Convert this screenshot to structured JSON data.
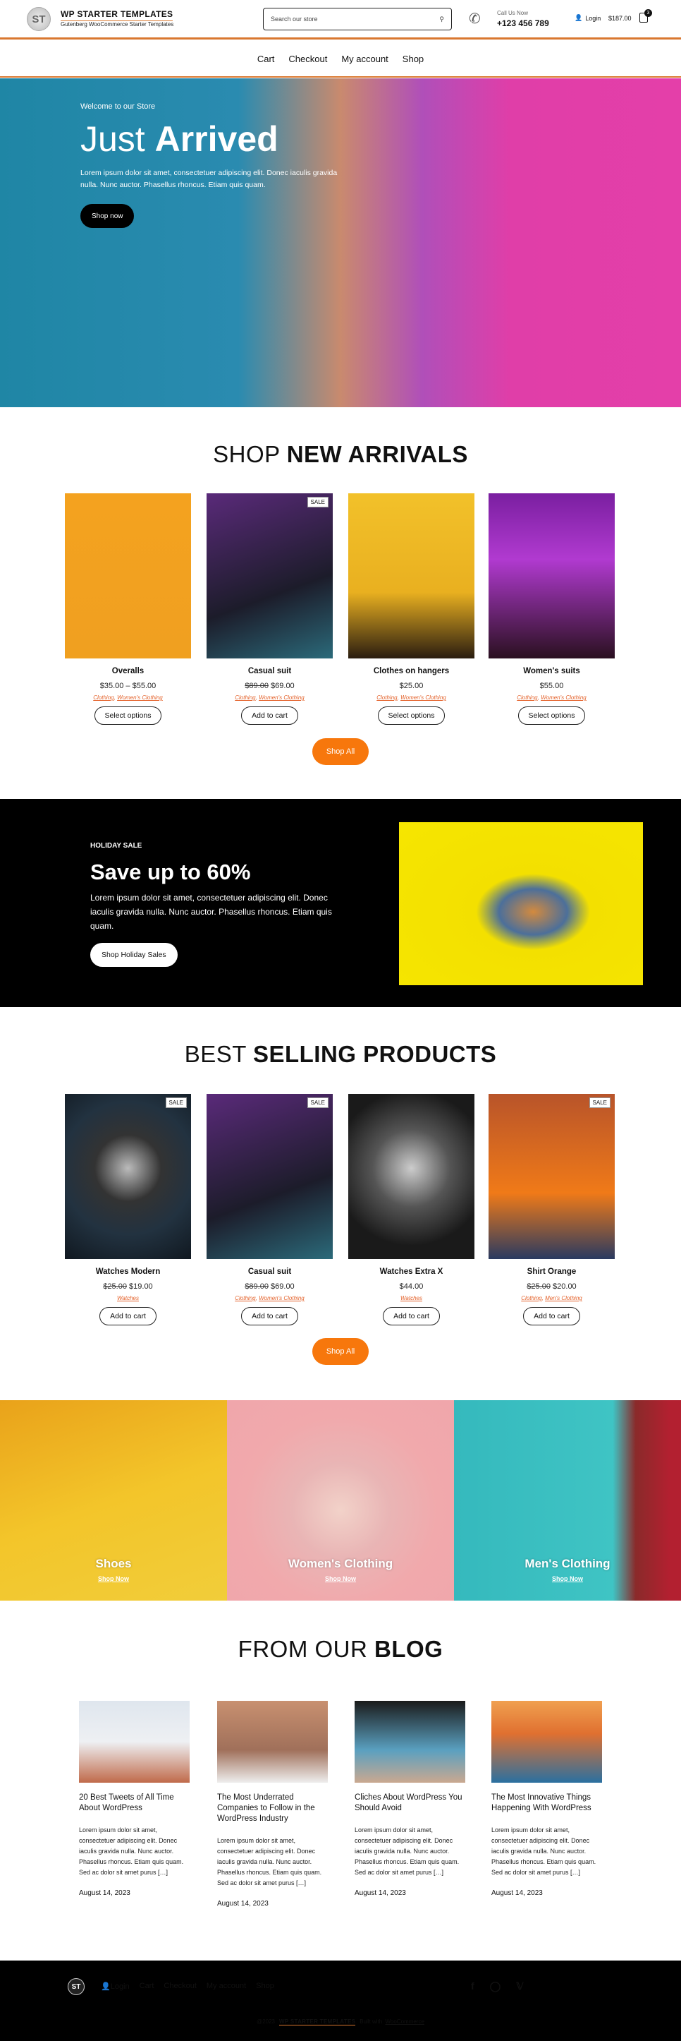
{
  "header": {
    "brand": "WP STARTER TEMPLATES",
    "tagline": "Gutenberg WooCommerce Starter Templates",
    "logo_text": "ST",
    "search_placeholder": "Search our store",
    "call_label": "Call Us Now",
    "phone": "+123 456 789",
    "login": "Login",
    "cart_total": "$187.00",
    "cart_count": "3"
  },
  "nav": [
    "Cart",
    "Checkout",
    "My account",
    "Shop"
  ],
  "hero": {
    "subtitle": "Welcome to our Store",
    "title_light": "Just ",
    "title_bold": "Arrived",
    "text": "Lorem ipsum dolor sit amet, consectetuer adipiscing elit. Donec iaculis gravida nulla. Nunc auctor. Phasellus rhoncus. Etiam quis quam.",
    "button": "Shop now"
  },
  "new_arrivals": {
    "title_light": "SHOP ",
    "title_bold": "NEW ARRIVALS",
    "shop_all": "Shop All",
    "products": [
      {
        "name": "Overalls",
        "price": "$35.00 – $55.00",
        "old_price": "",
        "sale": "",
        "cats": [
          "Clothing",
          "Women's Clothing"
        ],
        "button": "Select options"
      },
      {
        "name": "Casual suit",
        "price": "$69.00",
        "old_price": "$89.00",
        "sale": "SALE",
        "cats": [
          "Clothing",
          "Women's Clothing"
        ],
        "button": "Add to cart"
      },
      {
        "name": "Clothes on hangers",
        "price": "$25.00",
        "old_price": "",
        "sale": "",
        "cats": [
          "Clothing",
          "Women's Clothing"
        ],
        "button": "Select options"
      },
      {
        "name": "Women's suits",
        "price": "$55.00",
        "old_price": "",
        "sale": "",
        "cats": [
          "Clothing",
          "Women's Clothing"
        ],
        "button": "Select options"
      }
    ]
  },
  "holiday": {
    "label": "HOLIDAY SALE",
    "title": "Save up to 60%",
    "text": "Lorem ipsum dolor sit amet, consectetuer adipiscing elit. Donec iaculis gravida nulla. Nunc auctor. Phasellus rhoncus. Etiam quis quam.",
    "button": "Shop Holiday Sales"
  },
  "best_selling": {
    "title_light": "BEST ",
    "title_bold": "SELLING PRODUCTS",
    "shop_all": "Shop All",
    "products": [
      {
        "name": "Watches Modern",
        "price": "$19.00",
        "old_price": "$25.00",
        "sale": "SALE",
        "cats": [
          "Watches"
        ],
        "button": "Add to cart"
      },
      {
        "name": "Casual suit",
        "price": "$69.00",
        "old_price": "$89.00",
        "sale": "SALE",
        "cats": [
          "Clothing",
          "Women's Clothing"
        ],
        "button": "Add to cart"
      },
      {
        "name": "Watches Extra X",
        "price": "$44.00",
        "old_price": "",
        "sale": "",
        "cats": [
          "Watches"
        ],
        "button": "Add to cart"
      },
      {
        "name": "Shirt Orange",
        "price": "$20.00",
        "old_price": "$25.00",
        "sale": "SALE",
        "cats": [
          "Clothing",
          "Men's Clothing"
        ],
        "button": "Add to cart"
      }
    ]
  },
  "categories": [
    {
      "name": "Shoes",
      "link": "Shop Now"
    },
    {
      "name": "Women's Clothing",
      "link": "Shop Now"
    },
    {
      "name": "Men's Clothing",
      "link": "Shop Now"
    }
  ],
  "blog": {
    "title_light": "FROM OUR ",
    "title_bold": "BLOG",
    "posts": [
      {
        "title": "20 Best Tweets of All Time About WordPress",
        "excerpt": "Lorem ipsum dolor sit amet, consectetuer adipiscing elit. Donec iaculis gravida nulla. Nunc auctor. Phasellus rhoncus. Etiam quis quam. Sed ac dolor sit amet purus […]",
        "date": "August 14, 2023"
      },
      {
        "title": "The Most Underrated Companies to Follow in the WordPress Industry",
        "excerpt": "Lorem ipsum dolor sit amet, consectetuer adipiscing elit. Donec iaculis gravida nulla. Nunc auctor. Phasellus rhoncus. Etiam quis quam. Sed ac dolor sit amet purus […]",
        "date": "August 14, 2023"
      },
      {
        "title": "Cliches About WordPress You Should Avoid",
        "excerpt": "Lorem ipsum dolor sit amet, consectetuer adipiscing elit. Donec iaculis gravida nulla. Nunc auctor. Phasellus rhoncus. Etiam quis quam. Sed ac dolor sit amet purus […]",
        "date": "August 14, 2023"
      },
      {
        "title": "The Most Innovative Things Happening With WordPress",
        "excerpt": "Lorem ipsum dolor sit amet, consectetuer adipiscing elit. Donec iaculis gravida nulla. Nunc auctor. Phasellus rhoncus. Etiam quis quam. Sed ac dolor sit amet purus […]",
        "date": "August 14, 2023"
      }
    ]
  },
  "footer": {
    "logo_text": "ST",
    "login": "Login",
    "nav": [
      "Cart",
      "Checkout",
      "My account",
      "Shop"
    ],
    "social": [
      "facebook-icon",
      "instagram-icon",
      "twitter-icon"
    ],
    "copyright": "@2023",
    "brand": "WP STARTER TEMPLATES",
    "built_with": "Built with",
    "woo": "WooCommerce"
  },
  "colors": {
    "accent": "#f7770c",
    "line": "#d9772f",
    "category_link": "#e4622b"
  }
}
